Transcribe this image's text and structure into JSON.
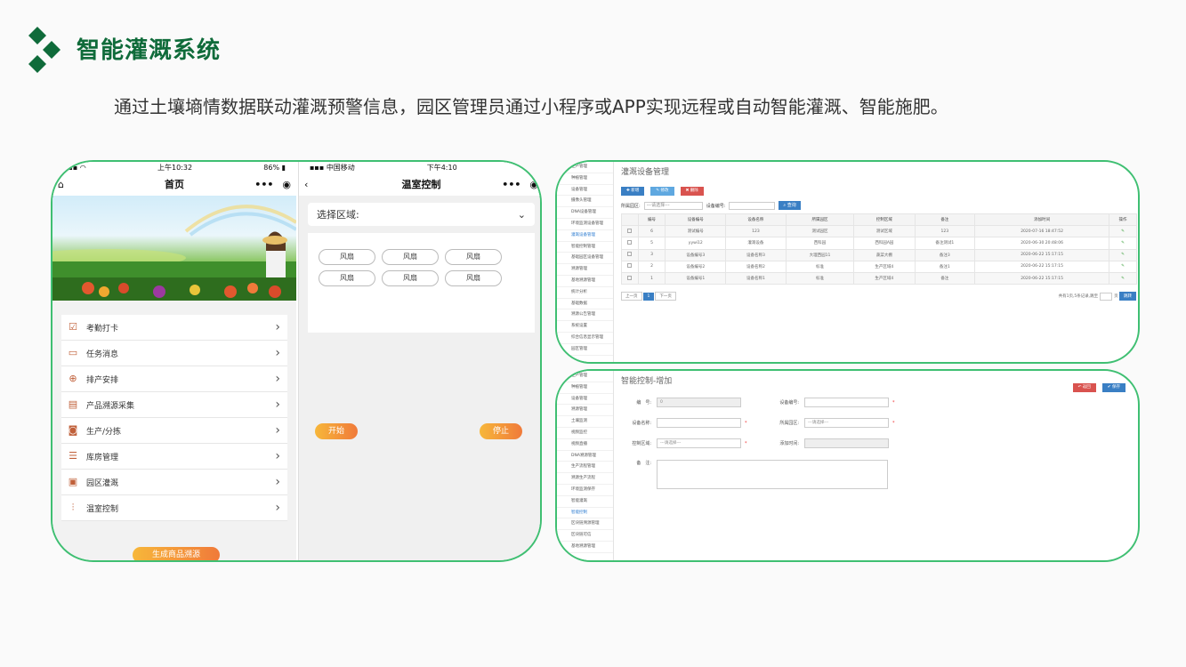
{
  "page": {
    "title": "智能灌溉系统",
    "subtitle": "通过土壤墒情数据联动灌溉预警信息，园区管理员通过小程序或APP实现远程或自动智能灌溉、智能施肥。"
  },
  "colors": {
    "brand_green": "#0f6b3a",
    "frame_green": "#3fbf72",
    "orange_start": "#f7b73a",
    "orange_end": "#f07a3a",
    "blue": "#3a7fc4"
  },
  "phone1": {
    "status": {
      "time": "上午10:32",
      "battery": "86%"
    },
    "nav_title": "首页",
    "menu": [
      {
        "label": "考勤打卡",
        "icon": "calendar-check-icon"
      },
      {
        "label": "任务消息",
        "icon": "chat-icon"
      },
      {
        "label": "排产安排",
        "icon": "plus-circle-icon"
      },
      {
        "label": "产品溯源采集",
        "icon": "document-icon"
      },
      {
        "label": "生产/分拣",
        "icon": "camera-icon"
      },
      {
        "label": "库房管理",
        "icon": "list-icon"
      },
      {
        "label": "园区灌溉",
        "icon": "irrigation-icon"
      },
      {
        "label": "温室控制",
        "icon": "sliders-icon"
      }
    ],
    "generate_button": "生成商品溯源"
  },
  "phone2": {
    "status": {
      "carrier": "中国移动",
      "time": "下午4:10"
    },
    "nav_title": "温室控制",
    "select_label": "选择区域:",
    "fans": [
      "风扇",
      "风扇",
      "风扇",
      "风扇",
      "风扇",
      "风扇"
    ],
    "start_button": "开始",
    "stop_button": "停止"
  },
  "win1": {
    "page_title": "灌溉设备管理",
    "buttons": {
      "add": "新增",
      "edit": "修改",
      "delete": "删除"
    },
    "sidebar": [
      "生产管理",
      "种植管理",
      "设备管理",
      "摄像头管理",
      "DNA设备管理",
      "环境监测设备管理",
      "灌溉设备管理",
      "智能控制管理",
      "基础园区设备管理",
      "溯源管理",
      "基地溯源管理",
      "统计分析",
      "基础数据",
      "溯源公告管理",
      "系统设置",
      "综合信息显示管理",
      "园区管理"
    ],
    "filters": {
      "park_label": "所属园区:",
      "park_placeholder": "---请选择---",
      "code_label": "设备编号:",
      "search": "查询"
    },
    "columns": [
      "",
      "编号",
      "设备编号",
      "设备名称",
      "所属园区",
      "控制区域",
      "备注",
      "添加时间",
      "操作"
    ],
    "rows": [
      [
        "",
        "6",
        "测试编号",
        "123",
        "测试园区",
        "测试区域",
        "123",
        "2020-07-16 18:47:52",
        ""
      ],
      [
        "",
        "5",
        "yywi12",
        "灌溉设备",
        "西科园",
        "西科园A园",
        "备注测试1",
        "2020-06-30 20:48:06",
        ""
      ],
      [
        "",
        "3",
        "设备编号3",
        "设备名称3",
        "大理西园11",
        "蔬菜大棚",
        "备注3",
        "2020-06-22 15:17:15",
        ""
      ],
      [
        "",
        "2",
        "设备编号2",
        "设备名称2",
        "标准",
        "生产区域4",
        "备注1",
        "2020-06-22 15:17:15",
        ""
      ],
      [
        "",
        "1",
        "设备编号1",
        "设备名称1",
        "标准",
        "生产区域4",
        "备注",
        "2020-06-22 15:17:15",
        ""
      ]
    ],
    "pager": {
      "prev": "上一页",
      "page": "1",
      "next": "下一页",
      "summary": "共有1页,5条记录,跳至",
      "unit": "页",
      "go": "跳转"
    }
  },
  "win2": {
    "page_title": "智能控制-增加",
    "buttons": {
      "back": "返回",
      "save": "保存"
    },
    "sidebar": [
      "生产管理",
      "种植管理",
      "设备管理",
      "溯源管理",
      "土壤监测",
      "视频监控",
      "视频直播",
      "DNA溯源管理",
      "生产流程管理",
      "溯源生产流程",
      "环境监测保存",
      "智能灌溉",
      "智能控制",
      "区块链溯源管理",
      "区块链可信",
      "基地溯源管理"
    ],
    "fields": {
      "number_label": "编　号:",
      "number_value": "0",
      "code_label": "设备编号:",
      "name_label": "设备名称:",
      "park_label": "所属园区:",
      "park_placeholder": "---请选择---",
      "area_label": "控制区域:",
      "area_placeholder": "---请选择---",
      "time_label": "添加时间:",
      "note_label": "备　注:",
      "required": "*"
    }
  }
}
